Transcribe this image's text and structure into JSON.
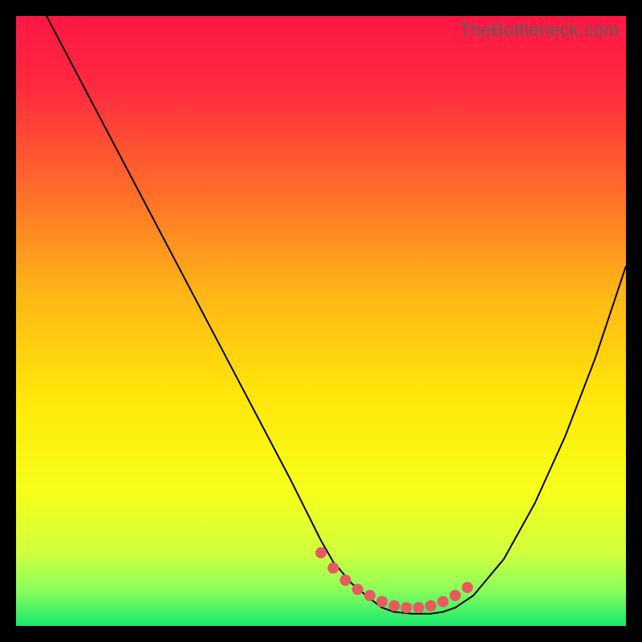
{
  "watermark": {
    "text": "TheBottleneck.com"
  },
  "chart_data": {
    "type": "line",
    "title": "",
    "xlabel": "",
    "ylabel": "",
    "xlim": [
      0,
      100
    ],
    "ylim": [
      0,
      100
    ],
    "grid": false,
    "axes_visible": false,
    "background_gradient": {
      "orientation": "vertical",
      "stops": [
        {
          "pos": 0.0,
          "color": "#ff1744"
        },
        {
          "pos": 0.12,
          "color": "#ff2b3f"
        },
        {
          "pos": 0.28,
          "color": "#ff6a2a"
        },
        {
          "pos": 0.45,
          "color": "#ffb417"
        },
        {
          "pos": 0.62,
          "color": "#ffe609"
        },
        {
          "pos": 0.78,
          "color": "#f6ff1a"
        },
        {
          "pos": 0.88,
          "color": "#d1ff3e"
        },
        {
          "pos": 0.94,
          "color": "#8dff5a"
        },
        {
          "pos": 1.0,
          "color": "#17e86e"
        }
      ]
    },
    "series": [
      {
        "name": "curve",
        "stroke": "#000000",
        "stroke_width": 2,
        "x": [
          5,
          10,
          15,
          20,
          25,
          30,
          35,
          40,
          45,
          48,
          50,
          52,
          55,
          58,
          60,
          62,
          65,
          68,
          70,
          72,
          75,
          80,
          85,
          90,
          95,
          100
        ],
        "y": [
          100,
          90.5,
          81,
          71.5,
          62,
          52.5,
          43,
          33.5,
          24,
          18,
          14,
          10.5,
          7,
          4.5,
          3,
          2.3,
          2,
          2,
          2.3,
          3,
          5,
          11,
          20,
          31,
          44,
          59
        ]
      }
    ],
    "markers": {
      "name": "flat-region",
      "color": "#e85a5f",
      "radius": 7,
      "x": [
        50,
        52,
        54,
        56,
        58,
        60,
        62,
        64,
        66,
        68,
        70,
        72,
        74
      ],
      "y": [
        12,
        9.5,
        7.5,
        6,
        5,
        4,
        3.3,
        3,
        3,
        3.3,
        4,
        5,
        6.3
      ]
    }
  }
}
